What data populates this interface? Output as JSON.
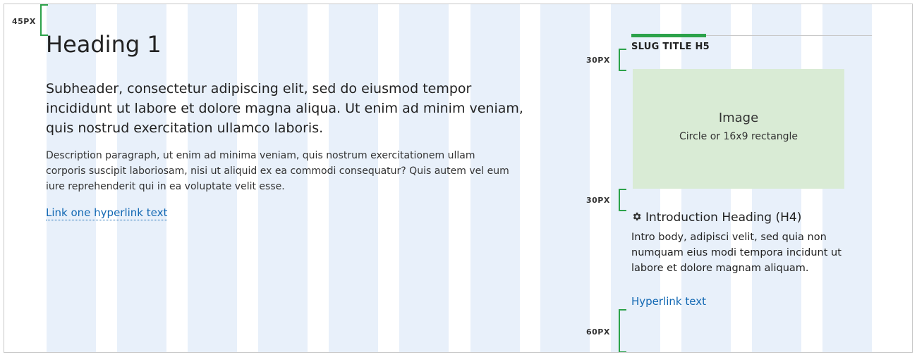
{
  "spacing_markers": {
    "top": "45PX",
    "slug_to_image": "30PX",
    "image_to_heading": "30PX",
    "bottom": "60PX"
  },
  "main": {
    "heading": "Heading 1",
    "subheader": "Subheader, consectetur adipiscing elit, sed do eiusmod tempor incididunt ut labore et dolore magna aliqua. Ut enim ad minim veniam, quis nostrud exercitation ullamco laboris.",
    "description": "Description paragraph, ut enim ad minima veniam, quis nostrum exercitationem ullam corporis suscipit laboriosam, nisi ut aliquid ex ea commodi consequatur? Quis autem vel eum iure reprehenderit qui in ea voluptate velit esse.",
    "link": "Link one hyperlink text"
  },
  "sidebar": {
    "slug_title": "SLUG TITLE H5",
    "image_title": "Image",
    "image_caption": "Circle or 16x9 rectangle",
    "intro_heading": "Introduction Heading (H4)",
    "intro_icon": "gear-icon",
    "intro_body": "Intro body, adipisci velit, sed quia non numquam eius modi tempora incidunt ut labore et dolore magnam aliquam.",
    "link": "Hyperlink text"
  },
  "colors": {
    "grid_column": "#e8f0fa",
    "accent_green": "#2ca24a",
    "link_blue": "#1268b3",
    "image_placeholder": "#d9ebd5"
  }
}
